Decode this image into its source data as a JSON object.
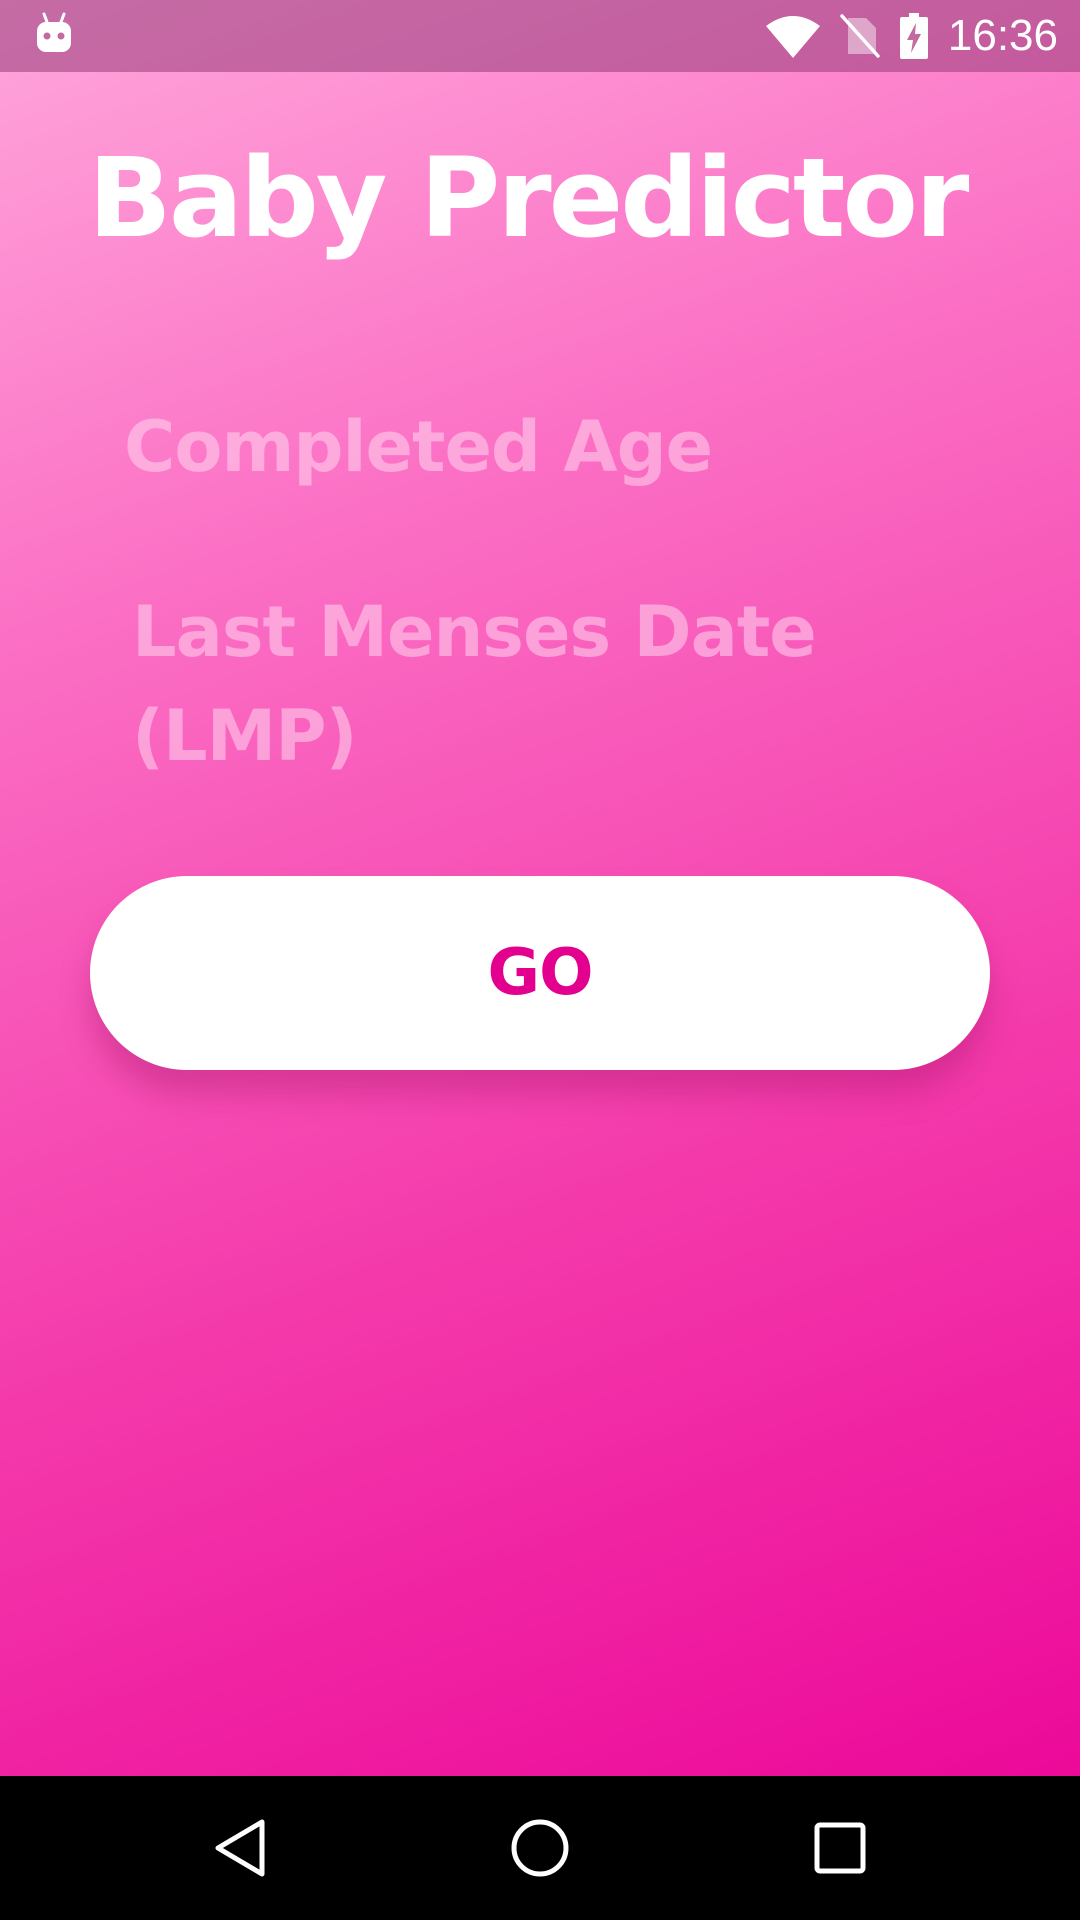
{
  "status_bar": {
    "time": "16:36",
    "left_icon": "android-notification-icon",
    "icons": [
      "wifi-icon",
      "no-sim-icon",
      "battery-charging-icon"
    ]
  },
  "app": {
    "title": "Baby Predictor",
    "fields": {
      "completed_age": "Completed Age",
      "last_menses_date": "Last Menses Date (LMP)"
    },
    "go_button": "GO"
  },
  "nav_bar": {
    "buttons": [
      "back-icon",
      "home-icon",
      "recents-icon"
    ]
  },
  "colors": {
    "gradient_start": "#ffa6db",
    "gradient_end": "#ec0999",
    "button_text": "#e4008f",
    "button_bg": "#ffffff",
    "title": "#ffffff"
  }
}
